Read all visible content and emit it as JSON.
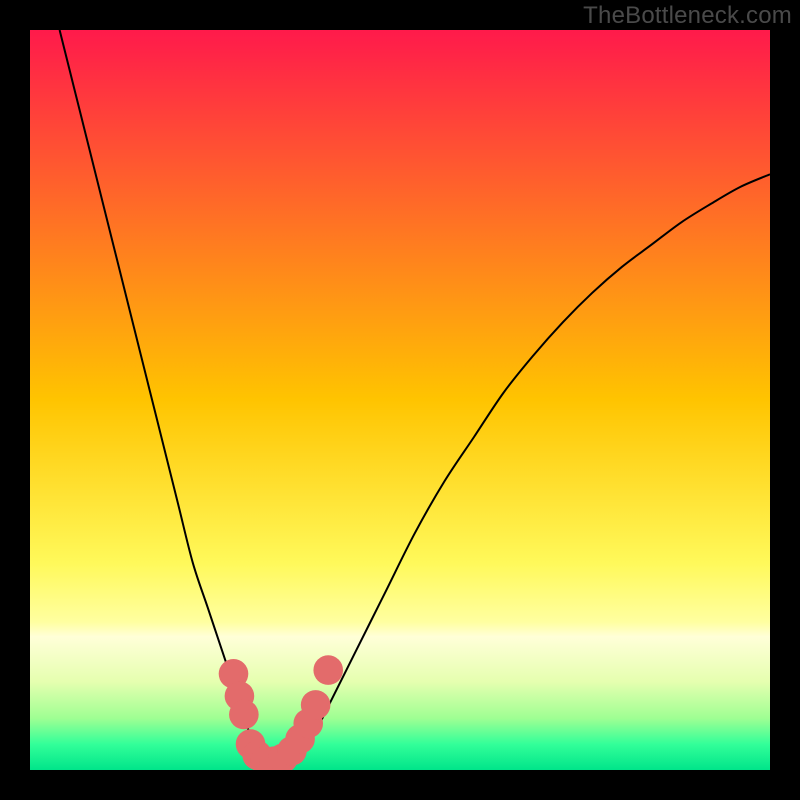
{
  "watermark": "TheBottleneck.com",
  "chart_data": {
    "type": "line",
    "title": "",
    "xlabel": "",
    "ylabel": "",
    "xlim": [
      0,
      100
    ],
    "ylim": [
      0,
      100
    ],
    "background_gradient": {
      "stops": [
        {
          "offset": 0.0,
          "color": "#ff1a4b"
        },
        {
          "offset": 0.5,
          "color": "#ffc400"
        },
        {
          "offset": 0.72,
          "color": "#fff95a"
        },
        {
          "offset": 0.8,
          "color": "#ffffa0"
        },
        {
          "offset": 0.82,
          "color": "#ffffd8"
        },
        {
          "offset": 0.88,
          "color": "#e6ffb0"
        },
        {
          "offset": 0.93,
          "color": "#9fff93"
        },
        {
          "offset": 0.965,
          "color": "#33ff99"
        },
        {
          "offset": 1.0,
          "color": "#00e58a"
        }
      ]
    },
    "series": [
      {
        "name": "curve",
        "color": "#000000",
        "x": [
          4,
          6,
          8,
          10,
          12,
          14,
          16,
          18,
          20,
          22,
          24,
          26,
          28,
          29,
          30,
          31,
          32,
          33,
          34,
          36,
          38,
          40,
          44,
          48,
          52,
          56,
          60,
          64,
          68,
          72,
          76,
          80,
          84,
          88,
          92,
          96,
          100
        ],
        "y": [
          100,
          92,
          84,
          76,
          68,
          60,
          52,
          44,
          36,
          28,
          22,
          16,
          10,
          7,
          4,
          2,
          1,
          1,
          1,
          2,
          4,
          8,
          16,
          24,
          32,
          39,
          45,
          51,
          56,
          60.5,
          64.5,
          68,
          71,
          74,
          76.5,
          78.8,
          80.5
        ]
      }
    ],
    "markers": {
      "name": "highlight-points",
      "color": "#e36b6b",
      "points": [
        {
          "x": 27.5,
          "y": 13
        },
        {
          "x": 28.3,
          "y": 10
        },
        {
          "x": 28.9,
          "y": 7.5
        },
        {
          "x": 29.8,
          "y": 3.5
        },
        {
          "x": 30.7,
          "y": 2.0
        },
        {
          "x": 31.8,
          "y": 1.2
        },
        {
          "x": 33.0,
          "y": 1.2
        },
        {
          "x": 34.2,
          "y": 1.6
        },
        {
          "x": 35.4,
          "y": 2.6
        },
        {
          "x": 36.5,
          "y": 4.2
        },
        {
          "x": 37.6,
          "y": 6.3
        },
        {
          "x": 38.6,
          "y": 8.8
        },
        {
          "x": 40.3,
          "y": 13.5
        }
      ],
      "radius": 2.0
    }
  }
}
